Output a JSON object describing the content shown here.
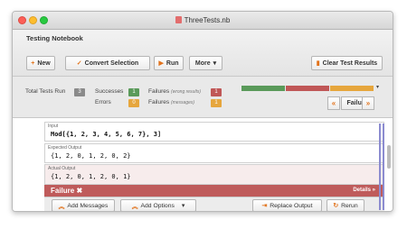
{
  "window": {
    "title": "ThreeTests.nb"
  },
  "toolbar": {
    "notebook_title": "Testing Notebook",
    "new_label": "New",
    "convert_label": "Convert Selection",
    "run_label": "Run",
    "more_label": "More",
    "clear_label": "Clear Test Results"
  },
  "stats": {
    "total_label": "Total Tests Run",
    "total_value": "3",
    "successes_label": "Successes",
    "successes_value": "1",
    "errors_label": "Errors",
    "errors_value": "0",
    "failures_label": "Failures",
    "failures_note": "(wrong results)",
    "failures_value": "1",
    "failures_msg_label": "Failures",
    "failures_msg_note": "(messages)",
    "failures_msg_value": "1",
    "colors": {
      "success": "#5a9a5a",
      "failure": "#c05757",
      "message": "#e6a63d",
      "neutral": "#8a8a8a"
    },
    "nav_prev": "«",
    "nav_status": "Failure",
    "nav_next": "»"
  },
  "test": {
    "input_label": "Input",
    "input_code": "Mod[{1, 2, 3, 4, 5, 6, 7}, 3]",
    "expected_label": "Expected Output",
    "expected_code": "{1, 2, 0, 1, 2, 0, 2}",
    "actual_label": "Actual Output",
    "actual_code": "{1, 2, 0, 1, 2, 0, 1}",
    "result_label": "Failure",
    "details_label": "Details »",
    "add_messages_label": "Add Messages",
    "add_options_label": "Add Options",
    "replace_output_label": "Replace Output",
    "rerun_label": "Rerun"
  }
}
